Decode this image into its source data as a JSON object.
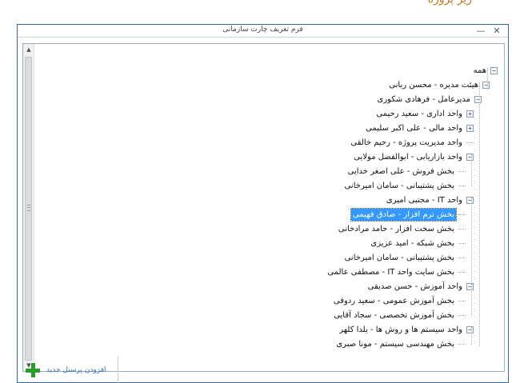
{
  "top_caption": "زیر پروژه",
  "window": {
    "title": "فرم تعریف چارت سازمانی",
    "minimize_glyph": "—",
    "close_glyph": "✕"
  },
  "tree": {
    "selected_index": 12,
    "nodes": [
      {
        "label": "همه",
        "toggle": "minus"
      },
      {
        "label": "هیئت مدیره - محسن ربانی",
        "toggle": "minus"
      },
      {
        "label": "مدیرعامل - فرهادی شکوری",
        "toggle": "minus"
      },
      {
        "label": "واحد اداری - سعید رحیمی",
        "toggle": "plus"
      },
      {
        "label": "واحد مالی - علی اکبر سلیمی",
        "toggle": "plus"
      },
      {
        "label": "واحد مدیریت پروژه - رحیم خالقی",
        "toggle": "none"
      },
      {
        "label": "واحد بازاریابی - ابوالفضل مولایی",
        "toggle": "minus"
      },
      {
        "label": "بخش فروش - علی اصغر خدایی",
        "toggle": "none"
      },
      {
        "label": "بخش پشتیبانی - سامان امیرخانی",
        "toggle": "none"
      },
      {
        "label": "واحد IT - مجتبی امیری",
        "toggle": "minus"
      },
      {
        "label": "بخش نرم افزار - صادق فهیمی",
        "toggle": "none"
      },
      {
        "label": "بخش سخت افزار - حامد مرادخانی",
        "toggle": "none"
      },
      {
        "label": "بخش شبکه - امید عزیزی",
        "toggle": "none"
      },
      {
        "label": "بخش پشتیبانی - سامان امیرخانی",
        "toggle": "none"
      },
      {
        "label": "بخش سایت واحد IT - مصطفی عالمی",
        "toggle": "none"
      },
      {
        "label": "واحد آموزش - حسن صدیقی",
        "toggle": "minus"
      },
      {
        "label": "بخش آموزش عمومی - سعید ردوفی",
        "toggle": "none"
      },
      {
        "label": "بخش آموزش تخصصی - سجاد آقایی",
        "toggle": "none"
      },
      {
        "label": "واحد سیستم ها و روش ها - یلدا کلهر",
        "toggle": "minus"
      },
      {
        "label": "بخش مهندسی سیستم - مونا صبری",
        "toggle": "none"
      }
    ]
  },
  "add_button": {
    "label": "افزودن پرسنل جدید",
    "icon": "plus-icon"
  },
  "colors": {
    "window_border": "#2f68b1",
    "selection": "#3399ff",
    "plus_icon": "#2a9a2a",
    "caption": "#c87a1e"
  }
}
